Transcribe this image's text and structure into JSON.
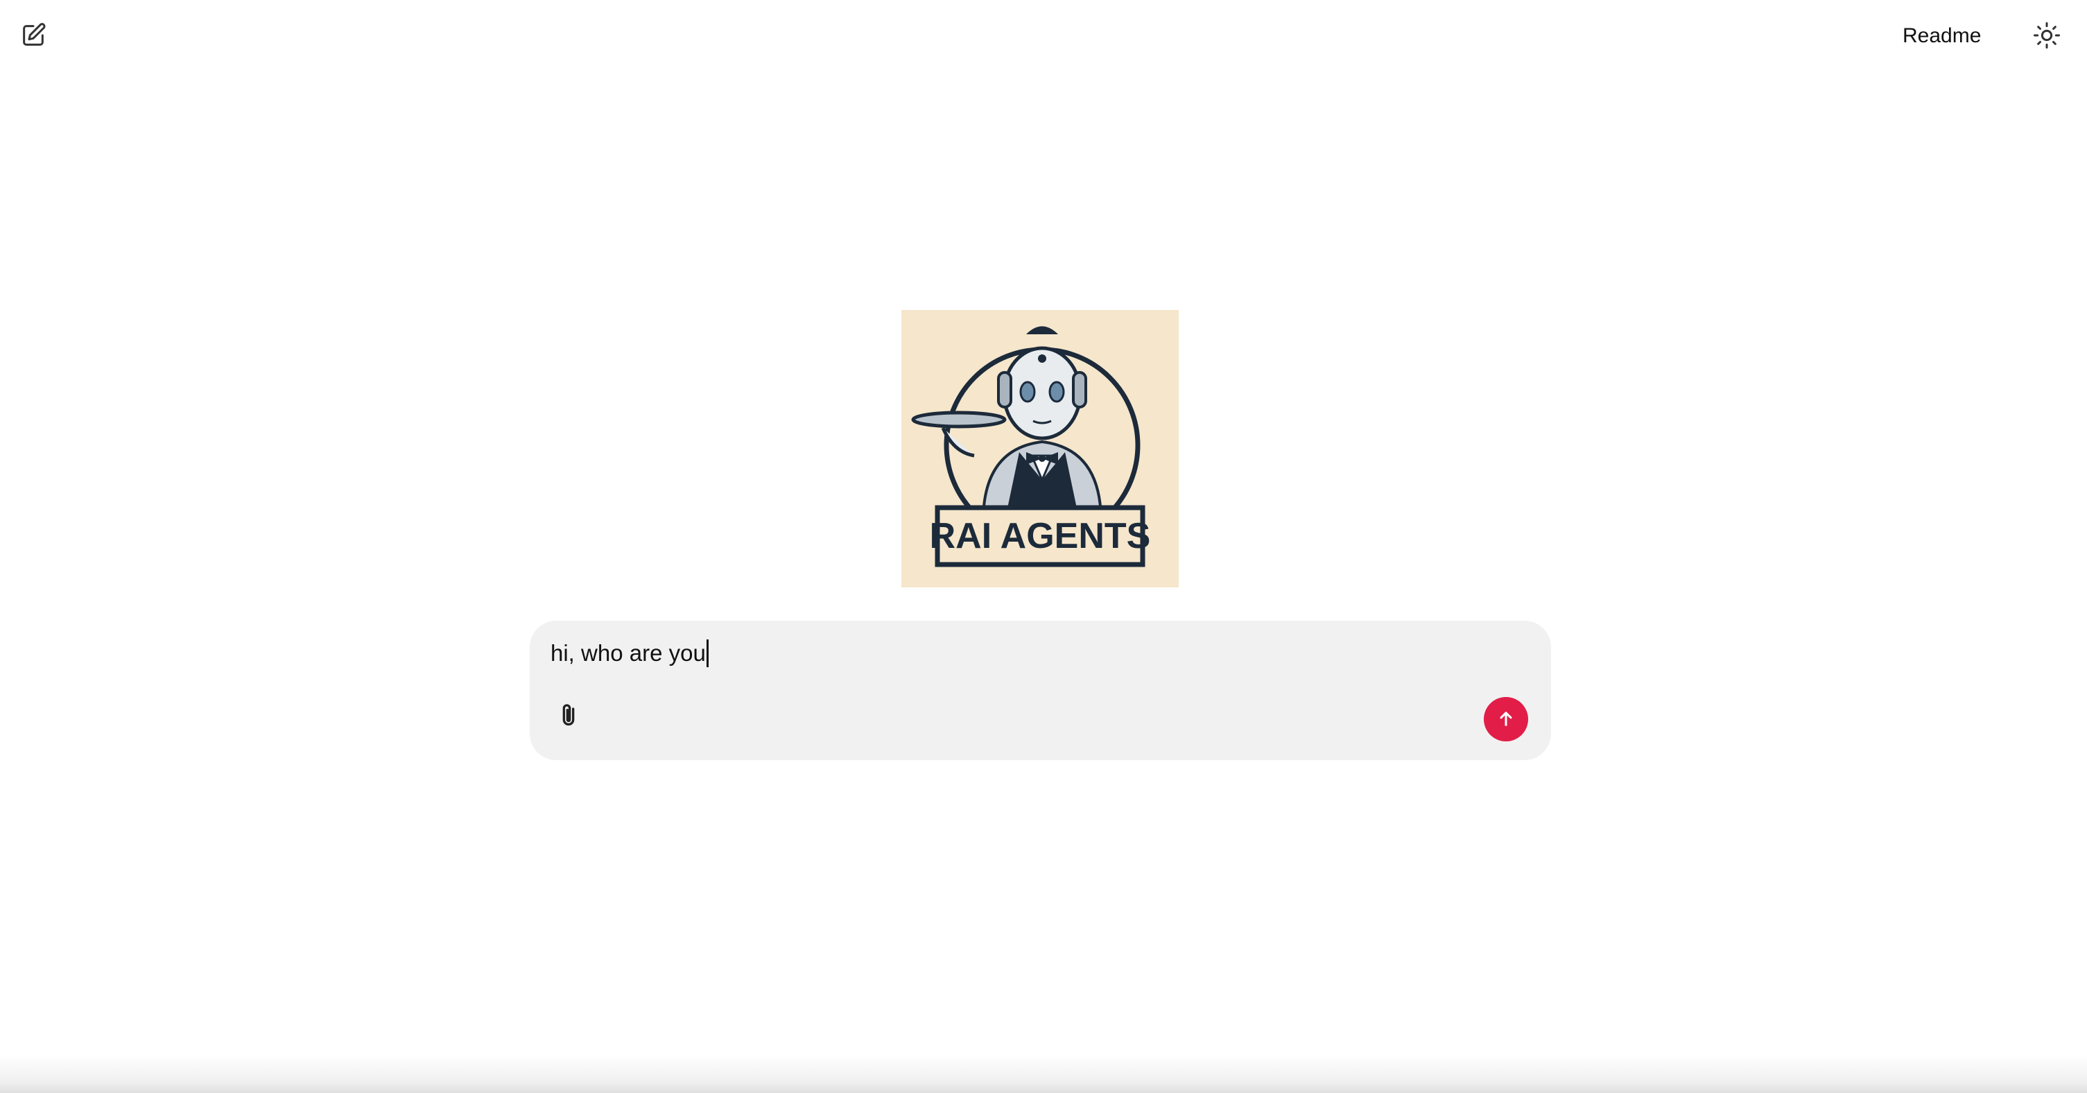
{
  "header": {
    "readme_label": "Readme",
    "new_chat_icon": "edit-square-icon",
    "theme_icon": "sun-icon"
  },
  "logo": {
    "text": "RAI AGENTS",
    "background_color": "#f5e6cc",
    "ink_color": "#1c2a3a"
  },
  "composer": {
    "input_value": "hi, who are you",
    "attach_icon": "paperclip-icon",
    "send_icon": "arrow-up-icon",
    "send_color": "#e11d48"
  }
}
